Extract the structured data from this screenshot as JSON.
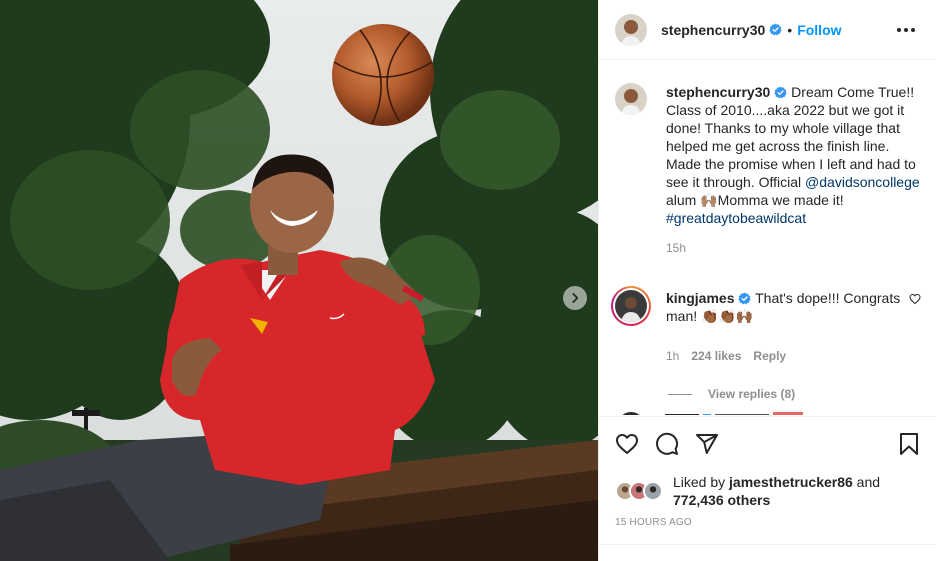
{
  "post": {
    "username": "stephencurry30",
    "follow_label": "Follow",
    "separator": "•",
    "caption": {
      "username": "stephencurry30",
      "text_1": " Dream Come True!! Class of 2010....aka 2022 but we got it done! Thanks to my whole village that helped me get across the finish line. Made the promise when I left and had to see it through. Official ",
      "mention": "@davidsoncollege",
      "text_2": " alum 🙌🏽Momma we made it! ",
      "hashtag": "#greatdaytobeawildcat",
      "age": "15h"
    },
    "comments": [
      {
        "username": "kingjames",
        "text": " That's dope!!! Congrats man! 👏🏾👏🏾🙌🏾",
        "age": "1h",
        "likes": "224 likes",
        "reply_label": "Reply",
        "view_replies": "View replies (8)"
      }
    ],
    "liked_by": {
      "prefix": "Liked by ",
      "user": "jamesthetrucker86",
      "and": " and",
      "others": "772,436 others"
    },
    "timestamp": "15 HOURS AGO"
  },
  "colors": {
    "accent": "#0095f6",
    "verified": "#3897f0",
    "shirt": "#d8272b",
    "muted": "#8e8e8e",
    "link": "#00376b"
  },
  "icons": [
    "chevron-right-icon",
    "more-icon",
    "verified-icon",
    "heart-icon",
    "comment-icon",
    "share-icon",
    "bookmark-icon"
  ]
}
